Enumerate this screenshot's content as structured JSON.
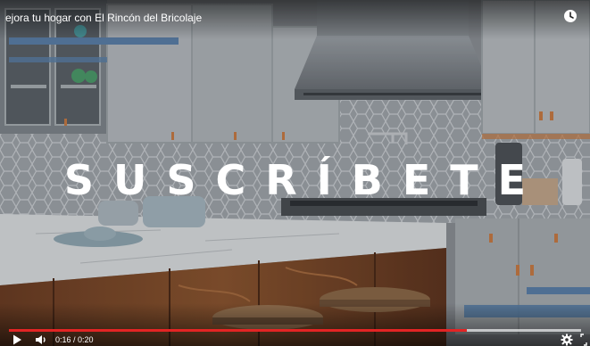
{
  "video": {
    "title": "ejora tu hogar con El Rincón del Bricolaje",
    "overlay_text": "SUSCRÍBETE"
  },
  "player": {
    "current_time": "0:16",
    "duration": "0:20",
    "time_separator": " / ",
    "played_fraction": 0.8,
    "buffered_fraction": 1.0
  },
  "icons": {
    "watch_later": "clock-icon",
    "play": "play-icon",
    "volume": "volume-icon",
    "settings": "gear-icon"
  },
  "colors": {
    "progress_played": "#e32424",
    "control_text": "#ffffff"
  }
}
